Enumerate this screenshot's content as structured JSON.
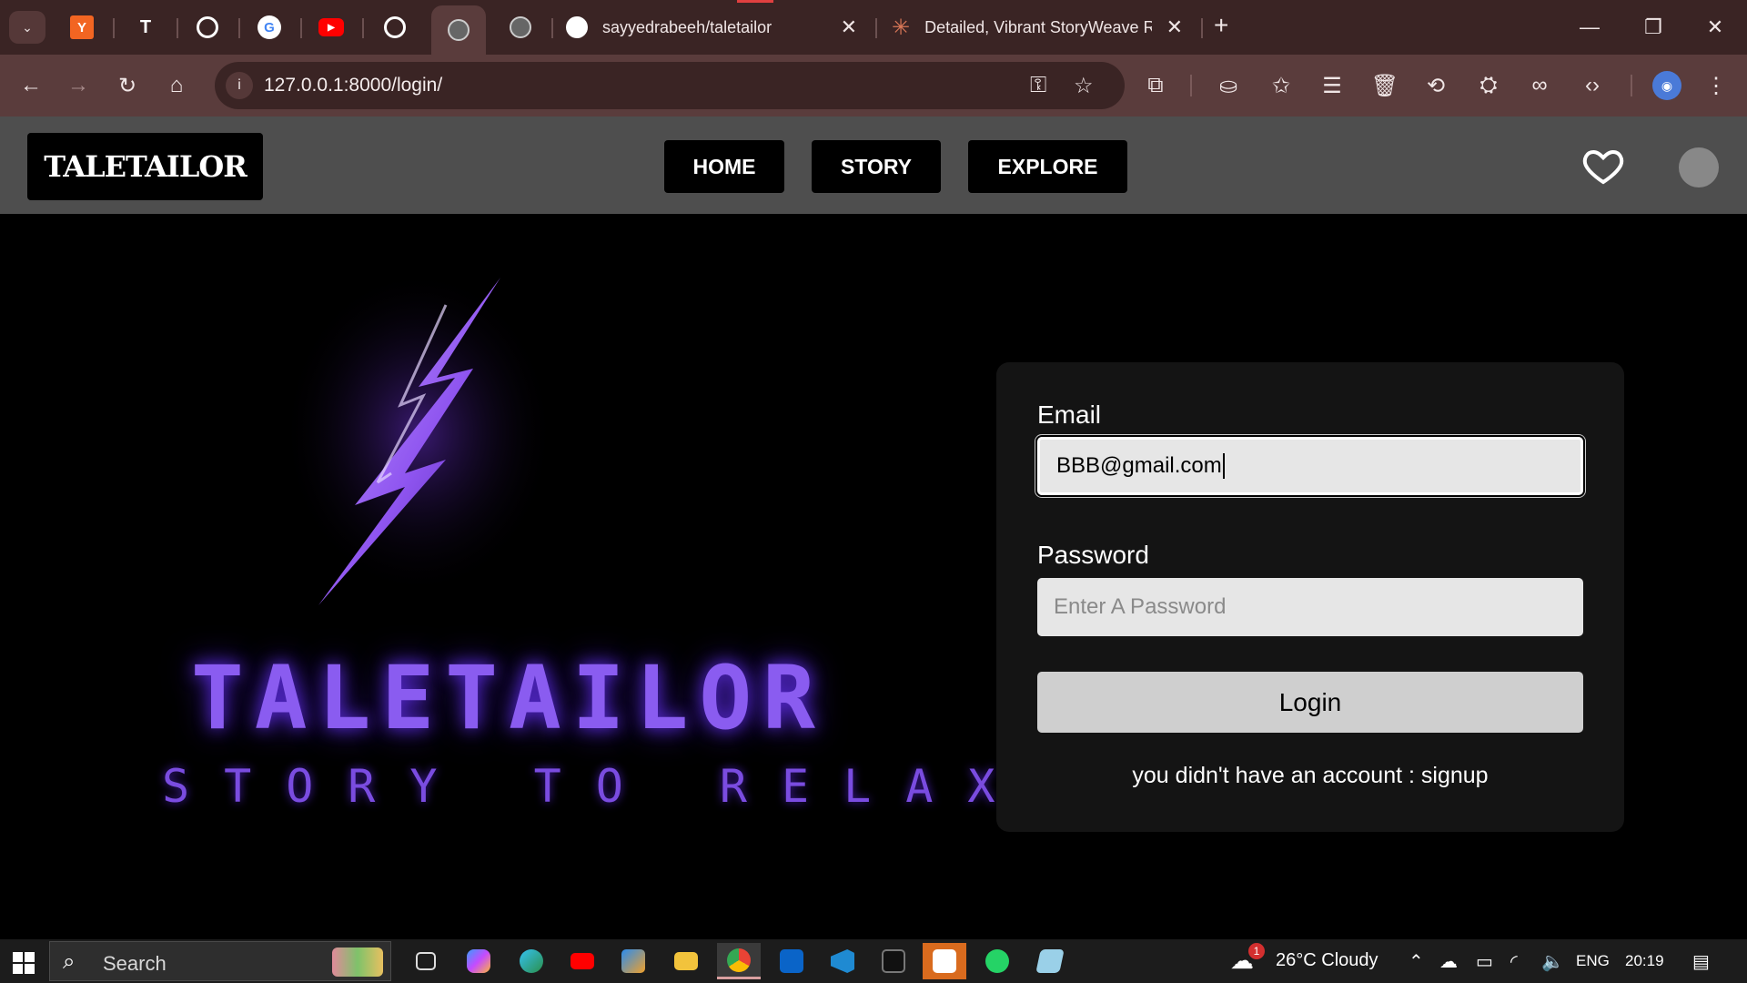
{
  "browser": {
    "tabs": [
      {
        "title": "sayyedrabeeh/taletailor",
        "icon": "github-icon"
      },
      {
        "title": "Detailed, Vibrant StoryWeave R",
        "icon": "claude-icon"
      }
    ],
    "address": "127.0.0.1:8000/login/",
    "new_tab_symbol": "+",
    "close_symbol": "✕"
  },
  "site": {
    "brand": "TALETAILOR",
    "nav": [
      "HOME",
      "STORY",
      "EXPLORE"
    ]
  },
  "hero": {
    "logo_word": "TALETAILOR",
    "tagline": "STORY TO RELAX",
    "accent_color": "#8a5cf0"
  },
  "login": {
    "email_label": "Email",
    "email_value": "BBB@gmail.com",
    "password_label": "Password",
    "password_placeholder": "Enter A Password",
    "button": "Login",
    "signup_text": "you didn't have an account : signup"
  },
  "taskbar": {
    "search_placeholder": "Search",
    "weather": "26°C  Cloudy",
    "weather_badge": "1",
    "language": "ENG",
    "time": "20:19"
  }
}
